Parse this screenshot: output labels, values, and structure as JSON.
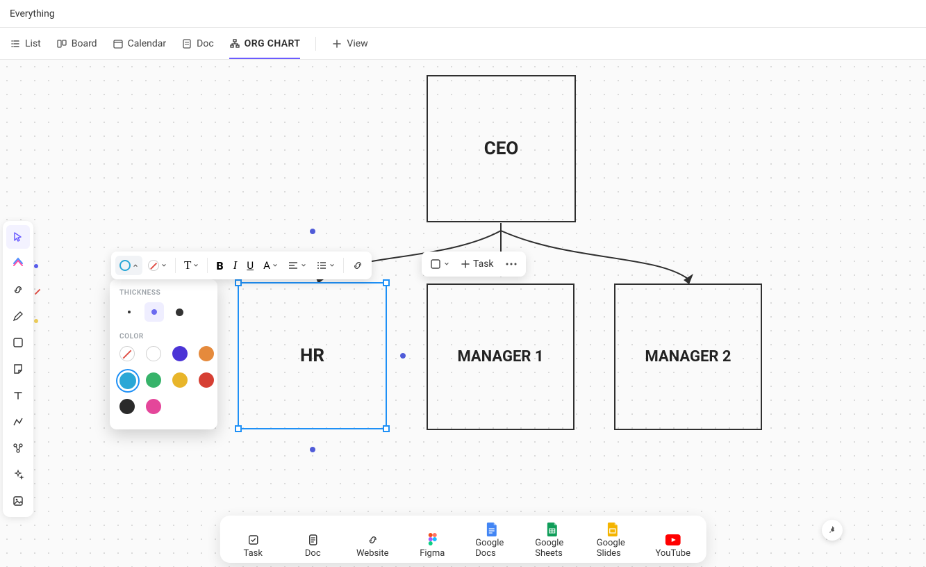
{
  "header": {
    "title": "Everything"
  },
  "views": {
    "list": "List",
    "board": "Board",
    "calendar": "Calendar",
    "doc": "Doc",
    "active": "ORG CHART",
    "add": "View"
  },
  "nodes": {
    "ceo": "CEO",
    "hr": "HR",
    "mgr1": "MANAGER 1",
    "mgr2": "MANAGER 2"
  },
  "fmt": {
    "task_label": "Task"
  },
  "popover": {
    "thickness_label": "THICKNESS",
    "color_label": "COLOR",
    "colors": {
      "none": "none",
      "white": "#ffffff",
      "violet": "#4b34d6",
      "orange": "#e58a3c",
      "cyan": "#2aa7d6",
      "green": "#37b36a",
      "yellow": "#e8b52a",
      "red": "#d63f33",
      "black": "#2a2a2a",
      "pink": "#e4469a"
    },
    "selected_color": "cyan",
    "selected_thickness": "medium"
  },
  "bottombar": {
    "task": "Task",
    "doc": "Doc",
    "website": "Website",
    "figma": "Figma",
    "gdocs": "Google Docs",
    "gsheets": "Google Sheets",
    "gslides": "Google Slides",
    "youtube": "YouTube"
  }
}
